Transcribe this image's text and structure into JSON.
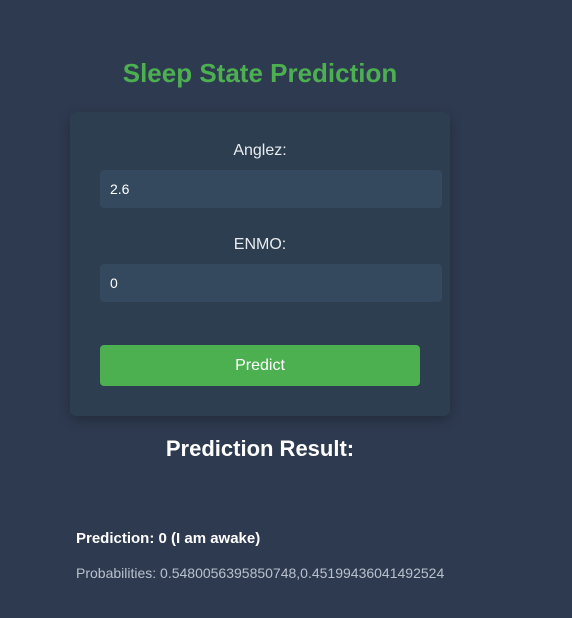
{
  "header": {
    "title": "Sleep State Prediction"
  },
  "form": {
    "anglez_label": "Anglez:",
    "anglez_value": "2.6",
    "enmo_label": "ENMO:",
    "enmo_value": "0",
    "predict_label": "Predict"
  },
  "result": {
    "heading": "Prediction Result:",
    "prediction_text": "Prediction: 0 (I am awake)",
    "probabilities_text": "Probabilities: 0.5480056395850748,0.45199436041492524"
  },
  "colors": {
    "background": "#2e3a50",
    "card": "#2c3e50",
    "input": "#34495e",
    "accent": "#4caf50"
  }
}
